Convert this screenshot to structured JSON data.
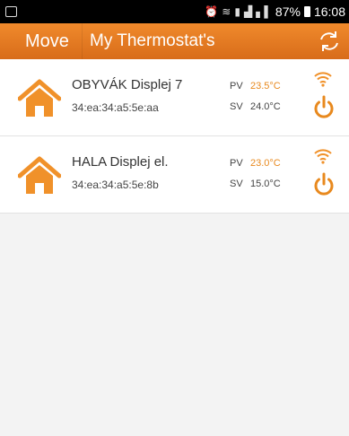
{
  "status": {
    "battery": "87%",
    "time": "16:08"
  },
  "header": {
    "move_label": "Move",
    "title": "My Thermostat's"
  },
  "devices": [
    {
      "name": "OBYVÁK Displej 7",
      "mac": "34:ea:34:a5:5e:aa",
      "pv_label": "PV",
      "pv": "23.5°C",
      "sv_label": "SV",
      "sv": "24.0°C"
    },
    {
      "name": "HALA Displej el.",
      "mac": "34:ea:34:a5:5e:8b",
      "pv_label": "PV",
      "pv": "23.0°C",
      "sv_label": "SV",
      "sv": "15.0°C"
    }
  ],
  "colors": {
    "accent": "#e8891e",
    "header": "#de721d"
  }
}
